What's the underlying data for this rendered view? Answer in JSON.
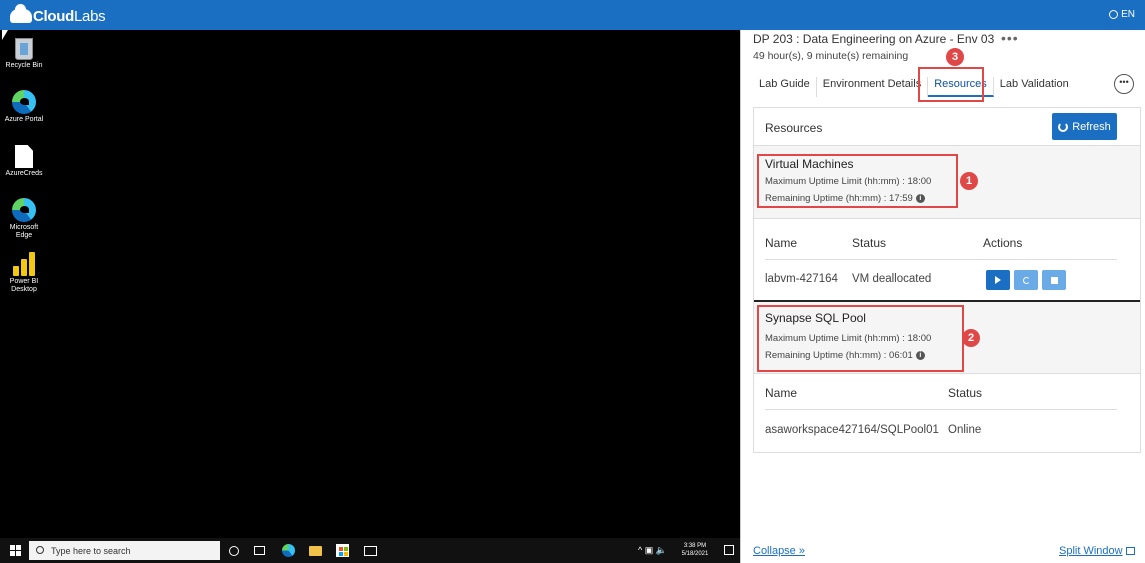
{
  "topbar": {
    "brand_bold": "Cloud",
    "brand_light": "Labs",
    "language": "EN"
  },
  "desktop": {
    "icons": [
      {
        "label": "Recycle Bin"
      },
      {
        "label": "Azure Portal"
      },
      {
        "label": "AzureCreds"
      },
      {
        "label": "Microsoft Edge"
      },
      {
        "label": "Power BI Desktop"
      }
    ]
  },
  "taskbar": {
    "search_placeholder": "Type here to search",
    "time": "3:38 PM",
    "date": "5/18/2021"
  },
  "panel": {
    "lab_title": "DP 203 : Data Engineering on Azure - Env 03",
    "menu_dots": "•••",
    "remaining": "49 hour(s), 9 minute(s) remaining",
    "tabs": [
      "Lab Guide",
      "Environment Details",
      "Resources",
      "Lab Validation"
    ],
    "more": "•••",
    "resources": {
      "title": "Resources",
      "refresh_label": "Refresh",
      "vm": {
        "title": "Virtual Machines",
        "max_uptime": "Maximum Uptime Limit (hh:mm) : 18:00",
        "remaining_uptime": "Remaining Uptime (hh:mm) : 17:59",
        "columns": [
          "Name",
          "Status",
          "Actions"
        ],
        "row": {
          "name": "labvm-427164",
          "status": "VM deallocated"
        }
      },
      "sql": {
        "title": "Synapse SQL Pool",
        "max_uptime": "Maximum Uptime Limit (hh:mm) : 18:00",
        "remaining_uptime": "Remaining Uptime (hh:mm) : 06:01",
        "columns": [
          "Name",
          "Status"
        ],
        "row": {
          "name": "asaworkspace427164/SQLPool01",
          "status": "Online"
        }
      }
    },
    "collapse": "Collapse »",
    "split_window": "Split Window"
  },
  "annotations": [
    "1",
    "2",
    "3"
  ],
  "colors": {
    "brand_blue": "#1b6fc2",
    "annotation_red": "#e04848"
  }
}
